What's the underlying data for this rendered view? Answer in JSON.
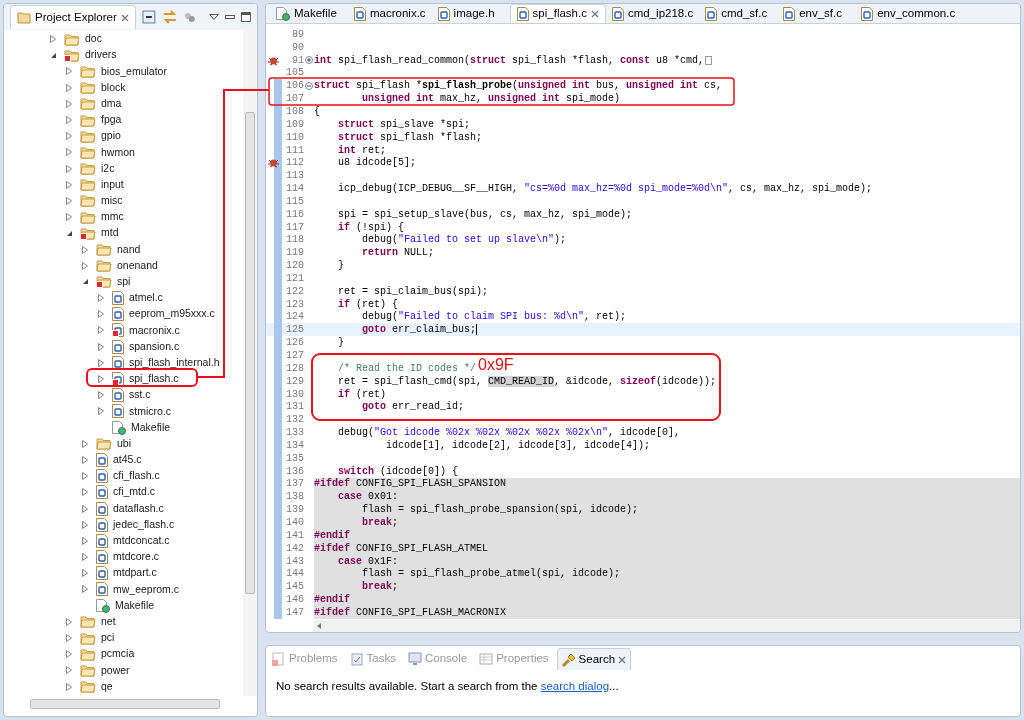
{
  "explorer": {
    "title": "Project Explorer",
    "tree": [
      {
        "label": "doc",
        "kind": "folder",
        "expanded": false
      },
      {
        "label": "drivers",
        "kind": "folder",
        "expanded": true,
        "error": true,
        "children": [
          {
            "label": "bios_emulator",
            "kind": "folder",
            "expanded": false
          },
          {
            "label": "block",
            "kind": "folder",
            "expanded": false
          },
          {
            "label": "dma",
            "kind": "folder",
            "expanded": false
          },
          {
            "label": "fpga",
            "kind": "folder",
            "expanded": false
          },
          {
            "label": "gpio",
            "kind": "folder",
            "expanded": false
          },
          {
            "label": "hwmon",
            "kind": "folder",
            "expanded": false
          },
          {
            "label": "i2c",
            "kind": "folder",
            "expanded": false
          },
          {
            "label": "input",
            "kind": "folder",
            "expanded": false
          },
          {
            "label": "misc",
            "kind": "folder",
            "expanded": false
          },
          {
            "label": "mmc",
            "kind": "folder",
            "expanded": false
          },
          {
            "label": "mtd",
            "kind": "folder",
            "expanded": true,
            "error": true,
            "children": [
              {
                "label": "nand",
                "kind": "folder",
                "expanded": false
              },
              {
                "label": "onenand",
                "kind": "folder",
                "expanded": false
              },
              {
                "label": "spi",
                "kind": "folder",
                "expanded": true,
                "error": true,
                "children": [
                  {
                    "label": "atmel.c",
                    "kind": "c",
                    "expanded": false
                  },
                  {
                    "label": "eeprom_m95xxx.c",
                    "kind": "c",
                    "expanded": false
                  },
                  {
                    "label": "macronix.c",
                    "kind": "c",
                    "expanded": false,
                    "error": true
                  },
                  {
                    "label": "spansion.c",
                    "kind": "c",
                    "expanded": false
                  },
                  {
                    "label": "spi_flash_internal.h",
                    "kind": "h",
                    "expanded": false
                  },
                  {
                    "label": "spi_flash.c",
                    "kind": "c",
                    "expanded": false,
                    "error": true
                  },
                  {
                    "label": "sst.c",
                    "kind": "c",
                    "expanded": false
                  },
                  {
                    "label": "stmicro.c",
                    "kind": "c",
                    "expanded": false
                  },
                  {
                    "label": "Makefile",
                    "kind": "makefile"
                  }
                ]
              },
              {
                "label": "ubi",
                "kind": "folder",
                "expanded": false
              },
              {
                "label": "at45.c",
                "kind": "c",
                "expanded": false
              },
              {
                "label": "cfi_flash.c",
                "kind": "c",
                "expanded": false
              },
              {
                "label": "cfi_mtd.c",
                "kind": "c",
                "expanded": false
              },
              {
                "label": "dataflash.c",
                "kind": "c",
                "expanded": false
              },
              {
                "label": "jedec_flash.c",
                "kind": "c",
                "expanded": false
              },
              {
                "label": "mtdconcat.c",
                "kind": "c",
                "expanded": false
              },
              {
                "label": "mtdcore.c",
                "kind": "c",
                "expanded": false
              },
              {
                "label": "mtdpart.c",
                "kind": "c",
                "expanded": false
              },
              {
                "label": "mw_eeprom.c",
                "kind": "c",
                "expanded": false
              },
              {
                "label": "Makefile",
                "kind": "makefile"
              }
            ]
          },
          {
            "label": "net",
            "kind": "folder",
            "expanded": false
          },
          {
            "label": "pci",
            "kind": "folder",
            "expanded": false
          },
          {
            "label": "pcmcia",
            "kind": "folder",
            "expanded": false
          },
          {
            "label": "power",
            "kind": "folder",
            "expanded": false
          },
          {
            "label": "qe",
            "kind": "folder",
            "expanded": false
          }
        ]
      }
    ]
  },
  "editor": {
    "tabs": [
      {
        "label": "Makefile",
        "kind": "makefile",
        "selected": false
      },
      {
        "label": "macronix.c",
        "kind": "c",
        "selected": false
      },
      {
        "label": "image.h",
        "kind": "h",
        "selected": false
      },
      {
        "label": "spi_flash.c",
        "kind": "c",
        "selected": true
      },
      {
        "label": "cmd_ip218.c",
        "kind": "c",
        "selected": false
      },
      {
        "label": "cmd_sf.c",
        "kind": "c",
        "selected": false
      },
      {
        "label": "env_sf.c",
        "kind": "c",
        "selected": false
      },
      {
        "label": "env_common.c",
        "kind": "c",
        "selected": false
      }
    ],
    "lines": [
      {
        "number": "89"
      },
      {
        "number": "90"
      },
      {
        "number": "91",
        "marker": true,
        "folded": true,
        "tokens": [
          {
            "kind": "keyword",
            "text": "int"
          },
          {
            "kind": "plain",
            "text": " spi_flash_read_common("
          },
          {
            "kind": "keyword",
            "text": "struct"
          },
          {
            "kind": "plain",
            "text": " spi_flash *flash, "
          },
          {
            "kind": "keyword",
            "text": "const"
          },
          {
            "kind": "plain",
            "text": " u8 *cmd,"
          }
        ]
      },
      {
        "number": "105"
      },
      {
        "number": "106",
        "changed": true,
        "folded": false,
        "tokens": [
          {
            "kind": "keyword",
            "text": "struct"
          },
          {
            "kind": "plain",
            "text": " spi_flash *"
          },
          {
            "kind": "bold",
            "text": "spi_flash_probe"
          },
          {
            "kind": "plain",
            "text": "("
          },
          {
            "kind": "keyword",
            "text": "unsigned int"
          },
          {
            "kind": "plain",
            "text": " bus, "
          },
          {
            "kind": "keyword",
            "text": "unsigned int"
          },
          {
            "kind": "plain",
            "text": " cs,"
          }
        ]
      },
      {
        "number": "107",
        "changed": true,
        "tokens": [
          {
            "kind": "keyword",
            "text": "        unsigned int"
          },
          {
            "kind": "plain",
            "text": " max_hz, "
          },
          {
            "kind": "keyword",
            "text": "unsigned int"
          },
          {
            "kind": "plain",
            "text": " spi_mode)"
          }
        ]
      },
      {
        "number": "108",
        "changed": true,
        "tokens": [
          {
            "kind": "plain",
            "text": "{"
          }
        ]
      },
      {
        "number": "109",
        "changed": true,
        "tokens": [
          {
            "kind": "keyword",
            "text": "    struct"
          },
          {
            "kind": "plain",
            "text": " spi_slave *spi;"
          }
        ]
      },
      {
        "number": "110",
        "changed": true,
        "tokens": [
          {
            "kind": "keyword",
            "text": "    struct"
          },
          {
            "kind": "plain",
            "text": " spi_flash *flash;"
          }
        ]
      },
      {
        "number": "111",
        "changed": true,
        "tokens": [
          {
            "kind": "keyword",
            "text": "    int"
          },
          {
            "kind": "plain",
            "text": " ret;"
          }
        ]
      },
      {
        "number": "112",
        "changed": true,
        "marker": true,
        "tokens": [
          {
            "kind": "plain",
            "text": "    u8 idcode[5];"
          }
        ]
      },
      {
        "number": "113",
        "changed": true
      },
      {
        "number": "114",
        "changed": true,
        "tokens": [
          {
            "kind": "plain",
            "text": "    icp_debug(ICP_DEBUG__SF__HIGH, "
          },
          {
            "kind": "string",
            "text": "\"cs=%0d max_hz=%0d spi_mode=%0d\\n\""
          },
          {
            "kind": "plain",
            "text": ", cs, max_hz, spi_mode);"
          }
        ]
      },
      {
        "number": "115",
        "changed": true
      },
      {
        "number": "116",
        "changed": true,
        "tokens": [
          {
            "kind": "plain",
            "text": "    spi = spi_setup_slave(bus, cs, max_hz, spi_mode);"
          }
        ]
      },
      {
        "number": "117",
        "changed": true,
        "tokens": [
          {
            "kind": "keyword",
            "text": "    if"
          },
          {
            "kind": "plain",
            "text": " (!spi) {"
          }
        ]
      },
      {
        "number": "118",
        "changed": true,
        "tokens": [
          {
            "kind": "plain",
            "text": "        debug("
          },
          {
            "kind": "string",
            "text": "\"Failed to set up slave\\n\""
          },
          {
            "kind": "plain",
            "text": ");"
          }
        ]
      },
      {
        "number": "119",
        "changed": true,
        "tokens": [
          {
            "kind": "keyword",
            "text": "        return"
          },
          {
            "kind": "plain",
            "text": " NULL;"
          }
        ]
      },
      {
        "number": "120",
        "changed": true,
        "tokens": [
          {
            "kind": "plain",
            "text": "    }"
          }
        ]
      },
      {
        "number": "121",
        "changed": true
      },
      {
        "number": "122",
        "changed": true,
        "tokens": [
          {
            "kind": "plain",
            "text": "    ret = spi_claim_bus(spi);"
          }
        ]
      },
      {
        "number": "123",
        "changed": true,
        "tokens": [
          {
            "kind": "keyword",
            "text": "    if"
          },
          {
            "kind": "plain",
            "text": " (ret) {"
          }
        ]
      },
      {
        "number": "124",
        "changed": true,
        "tokens": [
          {
            "kind": "plain",
            "text": "        debug("
          },
          {
            "kind": "string",
            "text": "\"Failed to claim SPI bus: %d\\n\""
          },
          {
            "kind": "plain",
            "text": ", ret);"
          }
        ]
      },
      {
        "number": "125",
        "changed": true,
        "current": true,
        "tokens": [
          {
            "kind": "keyword",
            "text": "        goto"
          },
          {
            "kind": "plain",
            "text": " err_claim_bus;"
          }
        ]
      },
      {
        "number": "126",
        "changed": true,
        "tokens": [
          {
            "kind": "plain",
            "text": "    }"
          }
        ]
      },
      {
        "number": "127",
        "changed": true
      },
      {
        "number": "128",
        "changed": true,
        "tokens": [
          {
            "kind": "comment",
            "text": "    /* Read the ID codes */"
          }
        ]
      },
      {
        "number": "129",
        "changed": true,
        "tokens": [
          {
            "kind": "plain",
            "text": "    ret = spi_flash_cmd(spi, "
          },
          {
            "kind": "occurrence",
            "text": "CMD_READ_ID"
          },
          {
            "kind": "plain",
            "text": ", &idcode, "
          },
          {
            "kind": "keyword",
            "text": "sizeof"
          },
          {
            "kind": "plain",
            "text": "(idcode));"
          }
        ]
      },
      {
        "number": "130",
        "changed": true,
        "tokens": [
          {
            "kind": "keyword",
            "text": "    if"
          },
          {
            "kind": "plain",
            "text": " (ret)"
          }
        ]
      },
      {
        "number": "131",
        "changed": true,
        "tokens": [
          {
            "kind": "keyword",
            "text": "        goto"
          },
          {
            "kind": "plain",
            "text": " err_read_id;"
          }
        ]
      },
      {
        "number": "132",
        "changed": true
      },
      {
        "number": "133",
        "changed": true,
        "tokens": [
          {
            "kind": "plain",
            "text": "    debug("
          },
          {
            "kind": "string",
            "text": "\"Got idcode %02x %02x %02x %02x %02x\\n\""
          },
          {
            "kind": "plain",
            "text": ", idcode[0],"
          }
        ]
      },
      {
        "number": "134",
        "changed": true,
        "tokens": [
          {
            "kind": "plain",
            "text": "            idcode[1], idcode[2], idcode[3], idcode[4]);"
          }
        ]
      },
      {
        "number": "135",
        "changed": true
      },
      {
        "number": "136",
        "changed": true,
        "tokens": [
          {
            "kind": "keyword",
            "text": "    switch"
          },
          {
            "kind": "plain",
            "text": " (idcode[0]) {"
          }
        ]
      },
      {
        "number": "137",
        "changed": true,
        "inactive": true,
        "tokens": [
          {
            "kind": "directive",
            "text": "#ifdef"
          },
          {
            "kind": "plain",
            "text": " CONFIG_SPI_FLASH_SPANSION"
          }
        ]
      },
      {
        "number": "138",
        "changed": true,
        "inactive": true,
        "tokens": [
          {
            "kind": "keyword",
            "text": "    case"
          },
          {
            "kind": "plain",
            "text": " 0x01:"
          }
        ]
      },
      {
        "number": "139",
        "changed": true,
        "inactive": true,
        "tokens": [
          {
            "kind": "plain",
            "text": "        flash = spi_flash_probe_spansion(spi, idcode);"
          }
        ]
      },
      {
        "number": "140",
        "changed": true,
        "inactive": true,
        "tokens": [
          {
            "kind": "keyword",
            "text": "        break"
          },
          {
            "kind": "plain",
            "text": ";"
          }
        ]
      },
      {
        "number": "141",
        "changed": true,
        "inactive": true,
        "tokens": [
          {
            "kind": "directive",
            "text": "#endif"
          }
        ]
      },
      {
        "number": "142",
        "changed": true,
        "inactive": true,
        "tokens": [
          {
            "kind": "directive",
            "text": "#ifdef"
          },
          {
            "kind": "plain",
            "text": " CONFIG_SPI_FLASH_ATMEL"
          }
        ]
      },
      {
        "number": "143",
        "changed": true,
        "inactive": true,
        "tokens": [
          {
            "kind": "keyword",
            "text": "    case"
          },
          {
            "kind": "plain",
            "text": " 0x1F:"
          }
        ]
      },
      {
        "number": "144",
        "changed": true,
        "inactive": true,
        "tokens": [
          {
            "kind": "plain",
            "text": "        flash = spi_flash_probe_atmel(spi, idcode);"
          }
        ]
      },
      {
        "number": "145",
        "changed": true,
        "inactive": true,
        "tokens": [
          {
            "kind": "keyword",
            "text": "        break"
          },
          {
            "kind": "plain",
            "text": ";"
          }
        ]
      },
      {
        "number": "146",
        "changed": true,
        "inactive": true,
        "tokens": [
          {
            "kind": "directive",
            "text": "#endif"
          }
        ]
      },
      {
        "number": "147",
        "changed": true,
        "inactive": true,
        "tokens": [
          {
            "kind": "directive",
            "text": "#ifdef"
          },
          {
            "kind": "plain",
            "text": " CONFIG_SPI_FLASH_MACRONIX"
          }
        ]
      }
    ]
  },
  "bottom_panel": {
    "tabs": [
      {
        "label": "Problems",
        "kind": "problems",
        "selected": false
      },
      {
        "label": "Tasks",
        "kind": "tasks",
        "selected": false
      },
      {
        "label": "Console",
        "kind": "console",
        "selected": false
      },
      {
        "label": "Properties",
        "kind": "properties",
        "selected": false
      },
      {
        "label": "Search",
        "kind": "search",
        "selected": true
      }
    ],
    "message": "No search results available. Start a search from the ",
    "link": "search dialog",
    "message_end": "..."
  },
  "annotation": {
    "label": "0x9F"
  }
}
